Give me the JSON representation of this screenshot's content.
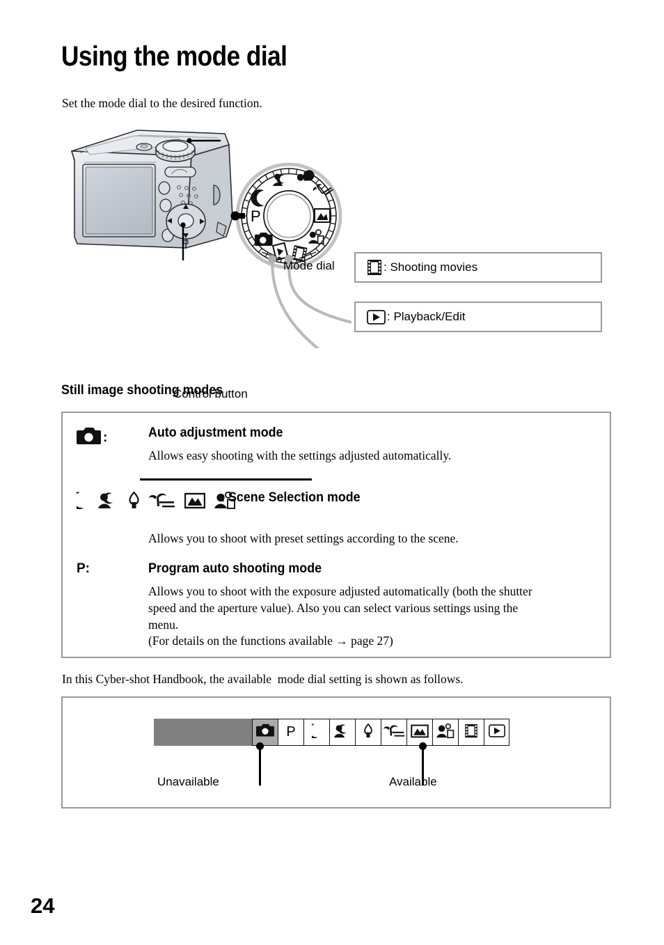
{
  "document": {
    "title": "Using the mode dial",
    "intro": "Set the mode dial to the desired function.",
    "page_number": "24"
  },
  "figure": {
    "mode_dial_label": "Mode dial",
    "control_button_label": "Control button",
    "dial_p_letter": "P",
    "callouts": [
      {
        "icon": "movie-film-icon",
        "text": ": Shooting movies"
      },
      {
        "icon": "playback-triangle-icon",
        "text": ": Playback/Edit"
      }
    ]
  },
  "still_section": {
    "heading": "Still image shooting modes",
    "auto": {
      "icon": "camera-icon",
      "colon": ":",
      "title": "Auto adjustment mode",
      "description": "Allows easy shooting with the settings adjusted automatically."
    },
    "scene": {
      "icons": [
        "twilight-moon-icon",
        "twilight-portrait-icon",
        "soft-snap-candle-icon",
        "beach-palm-icon",
        "landscape-mountain-icon",
        "high-sensitivity-person-icon"
      ],
      "colon": ":",
      "title": "Scene Selection mode",
      "description": "Allows you to shoot with preset settings according to the scene."
    },
    "program": {
      "key": "P:",
      "title": "Program auto shooting mode",
      "description_line1": "Allows you to shoot with the exposure adjusted automatically (both the shutter",
      "description_line2": "speed and the aperture value). Also you can select various settings using the",
      "description_line3": "menu.",
      "reference_prefix": "(For details on the functions available",
      "reference_arrow": "→",
      "reference_suffix": "page 27)"
    }
  },
  "handbook": {
    "line": "In this Cyber-shot Handbook, the available  mode dial setting is shown as follows."
  },
  "legend": {
    "cells": [
      {
        "icon": "camera-icon",
        "state": "unavailable"
      },
      {
        "icon": "p-letter",
        "label": "P",
        "state": "available"
      },
      {
        "icon": "twilight-moon-icon",
        "state": "available"
      },
      {
        "icon": "twilight-portrait-icon",
        "state": "available"
      },
      {
        "icon": "soft-snap-candle-icon",
        "state": "available"
      },
      {
        "icon": "beach-palm-icon",
        "state": "available"
      },
      {
        "icon": "landscape-mountain-icon",
        "state": "available"
      },
      {
        "icon": "high-sensitivity-person-icon",
        "state": "available"
      },
      {
        "icon": "movie-film-icon",
        "state": "available"
      },
      {
        "icon": "playback-triangle-icon",
        "state": "available"
      }
    ],
    "unavailable_label": "Unavailable",
    "available_label": "Available"
  },
  "colors": {
    "box_border": "#9a9a9a",
    "legend_bar": "#808080",
    "unavailable_cell": "#a9a9a9",
    "ink": "#000000",
    "camera_body": "#d9dde2"
  }
}
